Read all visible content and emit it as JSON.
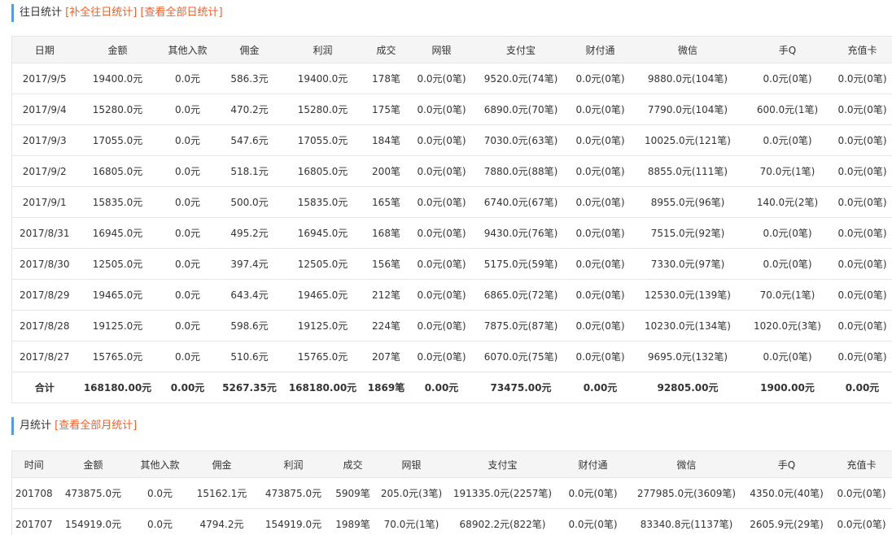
{
  "daily": {
    "title": "往日统计",
    "link_fill": "[补全往日统计]",
    "link_all": "[查看全部日统计]",
    "columns": [
      "日期",
      "金额",
      "其他入款",
      "佣金",
      "利润",
      "成交",
      "网银",
      "支付宝",
      "财付通",
      "微信",
      "手Q",
      "充值卡"
    ],
    "rows": [
      [
        "2017/9/5",
        "19400.0元",
        "0.0元",
        "586.3元",
        "19400.0元",
        "178笔",
        "0.0元(0笔)",
        "9520.0元(74笔)",
        "0.0元(0笔)",
        "9880.0元(104笔)",
        "0.0元(0笔)",
        "0.0元(0笔)"
      ],
      [
        "2017/9/4",
        "15280.0元",
        "0.0元",
        "470.2元",
        "15280.0元",
        "175笔",
        "0.0元(0笔)",
        "6890.0元(70笔)",
        "0.0元(0笔)",
        "7790.0元(104笔)",
        "600.0元(1笔)",
        "0.0元(0笔)"
      ],
      [
        "2017/9/3",
        "17055.0元",
        "0.0元",
        "547.6元",
        "17055.0元",
        "184笔",
        "0.0元(0笔)",
        "7030.0元(63笔)",
        "0.0元(0笔)",
        "10025.0元(121笔)",
        "0.0元(0笔)",
        "0.0元(0笔)"
      ],
      [
        "2017/9/2",
        "16805.0元",
        "0.0元",
        "518.1元",
        "16805.0元",
        "200笔",
        "0.0元(0笔)",
        "7880.0元(88笔)",
        "0.0元(0笔)",
        "8855.0元(111笔)",
        "70.0元(1笔)",
        "0.0元(0笔)"
      ],
      [
        "2017/9/1",
        "15835.0元",
        "0.0元",
        "500.0元",
        "15835.0元",
        "165笔",
        "0.0元(0笔)",
        "6740.0元(67笔)",
        "0.0元(0笔)",
        "8955.0元(96笔)",
        "140.0元(2笔)",
        "0.0元(0笔)"
      ],
      [
        "2017/8/31",
        "16945.0元",
        "0.0元",
        "495.2元",
        "16945.0元",
        "168笔",
        "0.0元(0笔)",
        "9430.0元(76笔)",
        "0.0元(0笔)",
        "7515.0元(92笔)",
        "0.0元(0笔)",
        "0.0元(0笔)"
      ],
      [
        "2017/8/30",
        "12505.0元",
        "0.0元",
        "397.4元",
        "12505.0元",
        "156笔",
        "0.0元(0笔)",
        "5175.0元(59笔)",
        "0.0元(0笔)",
        "7330.0元(97笔)",
        "0.0元(0笔)",
        "0.0元(0笔)"
      ],
      [
        "2017/8/29",
        "19465.0元",
        "0.0元",
        "643.4元",
        "19465.0元",
        "212笔",
        "0.0元(0笔)",
        "6865.0元(72笔)",
        "0.0元(0笔)",
        "12530.0元(139笔)",
        "70.0元(1笔)",
        "0.0元(0笔)"
      ],
      [
        "2017/8/28",
        "19125.0元",
        "0.0元",
        "598.6元",
        "19125.0元",
        "224笔",
        "0.0元(0笔)",
        "7875.0元(87笔)",
        "0.0元(0笔)",
        "10230.0元(134笔)",
        "1020.0元(3笔)",
        "0.0元(0笔)"
      ],
      [
        "2017/8/27",
        "15765.0元",
        "0.0元",
        "510.6元",
        "15765.0元",
        "207笔",
        "0.0元(0笔)",
        "6070.0元(75笔)",
        "0.0元(0笔)",
        "9695.0元(132笔)",
        "0.0元(0笔)",
        "0.0元(0笔)"
      ]
    ],
    "total": [
      "合计",
      "168180.00元",
      "0.00元",
      "5267.35元",
      "168180.00元",
      "1869笔",
      "0.00元",
      "73475.00元",
      "0.00元",
      "92805.00元",
      "1900.00元",
      "0.00元"
    ]
  },
  "monthly": {
    "title": "月统计",
    "link_all": "[查看全部月统计]",
    "columns": [
      "时间",
      "金额",
      "其他入款",
      "佣金",
      "利润",
      "成交",
      "网银",
      "支付宝",
      "财付通",
      "微信",
      "手Q",
      "充值卡"
    ],
    "rows": [
      [
        "201708",
        "473875.0元",
        "0.0元",
        "15162.1元",
        "473875.0元",
        "5909笔",
        "205.0元(3笔)",
        "191335.0元(2257笔)",
        "0.0元(0笔)",
        "277985.0元(3609笔)",
        "4350.0元(40笔)",
        "0.0元(0笔)"
      ],
      [
        "201707",
        "154919.0元",
        "0.0元",
        "4794.2元",
        "154919.0元",
        "1989笔",
        "70.0元(1笔)",
        "68902.2元(822笔)",
        "0.0元(0笔)",
        "83340.8元(1137笔)",
        "2605.9元(29笔)",
        "0.0元(0笔)"
      ]
    ]
  },
  "colors": {
    "accent_bar": "#5b9bd5",
    "link": "#e8622c",
    "header_bg": "#f5f5f5",
    "border": "#e6e6e6"
  }
}
